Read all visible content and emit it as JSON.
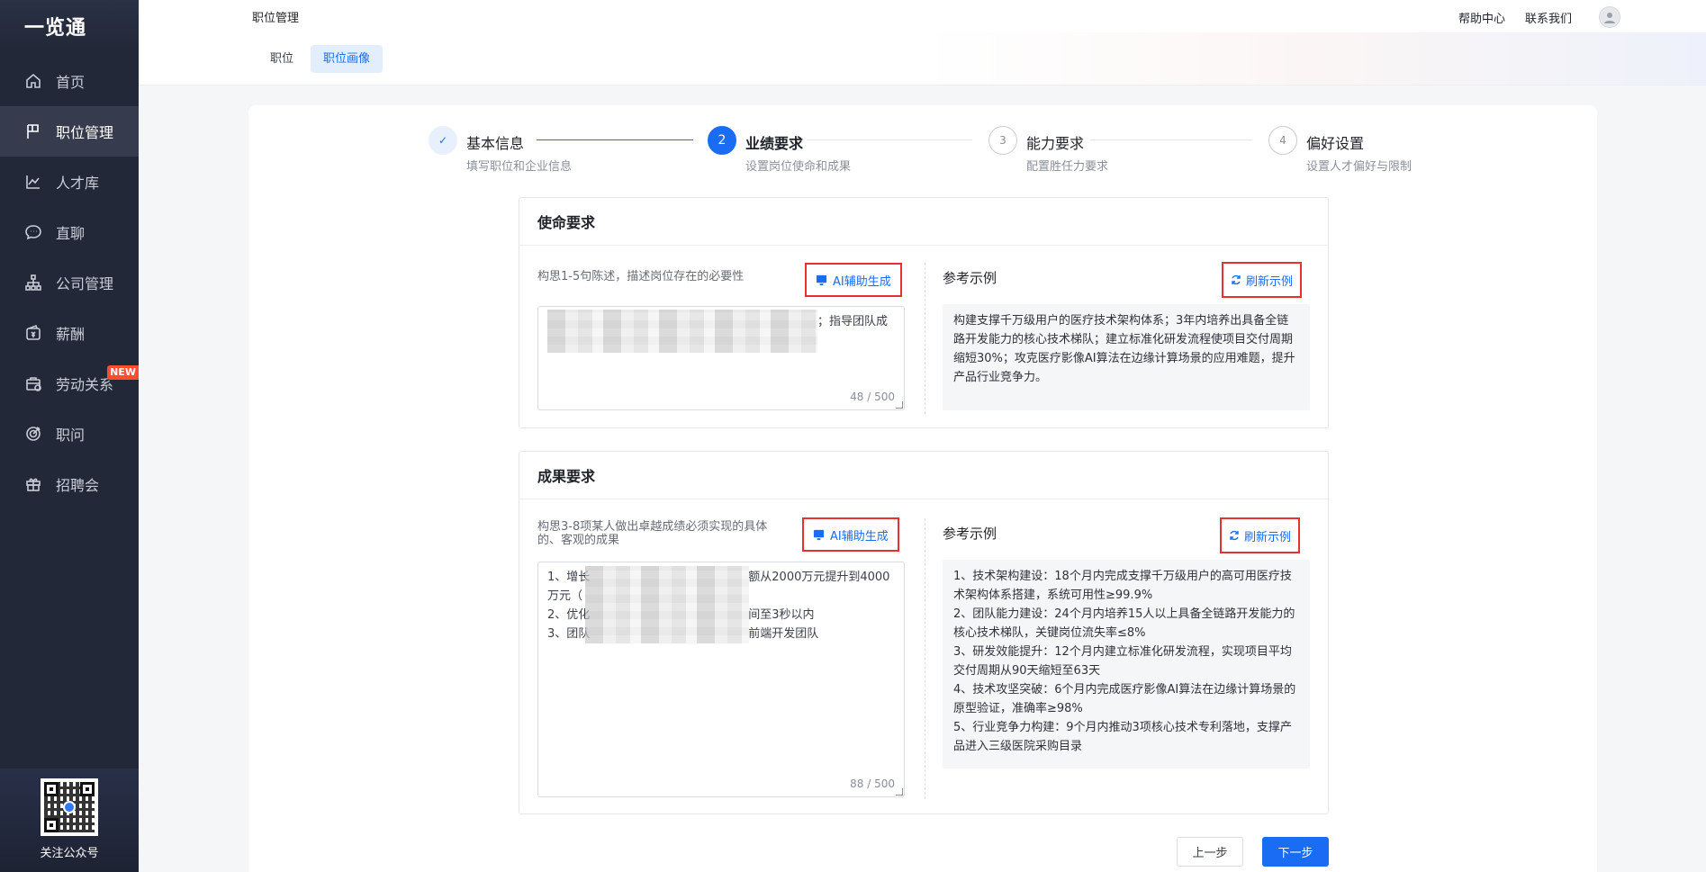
{
  "app": {
    "logo": "一览通"
  },
  "sidebar": {
    "items": [
      {
        "label": "首页",
        "icon": "home-icon"
      },
      {
        "label": "职位管理",
        "icon": "flag-icon",
        "active": true
      },
      {
        "label": "人才库",
        "icon": "chart-line-icon"
      },
      {
        "label": "直聊",
        "icon": "chat-bubble-icon"
      },
      {
        "label": "公司管理",
        "icon": "org-chart-icon"
      },
      {
        "label": "薪酬",
        "icon": "wallet-icon"
      },
      {
        "label": "劳动关系",
        "icon": "briefcase-icon",
        "badge": "NEW"
      },
      {
        "label": "职问",
        "icon": "target-icon"
      },
      {
        "label": "招聘会",
        "icon": "gift-icon"
      }
    ],
    "qr_label": "关注公众号"
  },
  "topbar": {
    "title": "职位管理",
    "help": "帮助中心",
    "contact": "联系我们"
  },
  "subtabs": [
    {
      "label": "职位",
      "active": false
    },
    {
      "label": "职位画像",
      "active": true
    }
  ],
  "steps": [
    {
      "number": "✓",
      "title": "基本信息",
      "subtitle": "填写职位和企业信息",
      "state": "done"
    },
    {
      "number": "2",
      "title": "业绩要求",
      "subtitle": "设置岗位使命和成果",
      "state": "current"
    },
    {
      "number": "3",
      "title": "能力要求",
      "subtitle": "配置胜任力要求",
      "state": "pending"
    },
    {
      "number": "4",
      "title": "偏好设置",
      "subtitle": "设置人才偏好与限制",
      "state": "pending"
    }
  ],
  "mission": {
    "heading": "使命要求",
    "hint": "构思1-5句陈述，描述岗位存在的必要性",
    "ai_button": "AI辅助生成",
    "text_visible_suffix": "；指导团队成",
    "counter": "48 / 500",
    "ref_title": "参考示例",
    "refresh_button": "刷新示例",
    "ref_text": "构建支撑千万级用户的医疗技术架构体系；3年内培养出具备全链路开发能力的核心技术梯队；建立标准化研发流程使项目交付周期缩短30%；攻克医疗影像AI算法在边缘计算场景的应用难题，提升产品行业竞争力。"
  },
  "results": {
    "heading": "成果要求",
    "hint": "构思3-8项某人做出卓越成绩必须实现的具体的、客观的成果",
    "ai_button": "AI辅助生成",
    "lines": [
      {
        "prefix": "1、增长",
        "suffix": "额从2000万元提升到4000"
      },
      {
        "prefix": "万元（",
        "suffix": ""
      },
      {
        "prefix": "2、优化",
        "suffix": "间至3秒以内"
      },
      {
        "prefix": "3、团队",
        "suffix": "前端开发团队"
      }
    ],
    "counter": "88 / 500",
    "ref_title": "参考示例",
    "refresh_button": "刷新示例",
    "ref_items": [
      "1、技术架构建设：18个月内完成支撑千万级用户的高可用医疗技术架构体系搭建，系统可用性≥99.9%",
      "2、团队能力建设：24个月内培养15人以上具备全链路开发能力的核心技术梯队，关键岗位流失率≤8%",
      "3、研发效能提升：12个月内建立标准化研发流程，实现项目平均交付周期从90天缩短至63天",
      "4、技术攻坚突破：6个月内完成医疗影像AI算法在边缘计算场景的原型验证，准确率≥98%",
      "5、行业竞争力构建：9个月内推动3项核心技术专利落地，支撑产品进入三级医院采购目录"
    ]
  },
  "footer": {
    "prev": "上一步",
    "next": "下一步"
  },
  "colors": {
    "accent": "#1a6cf5",
    "sidebar_bg": "#232838",
    "highlight_border": "#e8302f",
    "badge": "#ff4d2d"
  }
}
